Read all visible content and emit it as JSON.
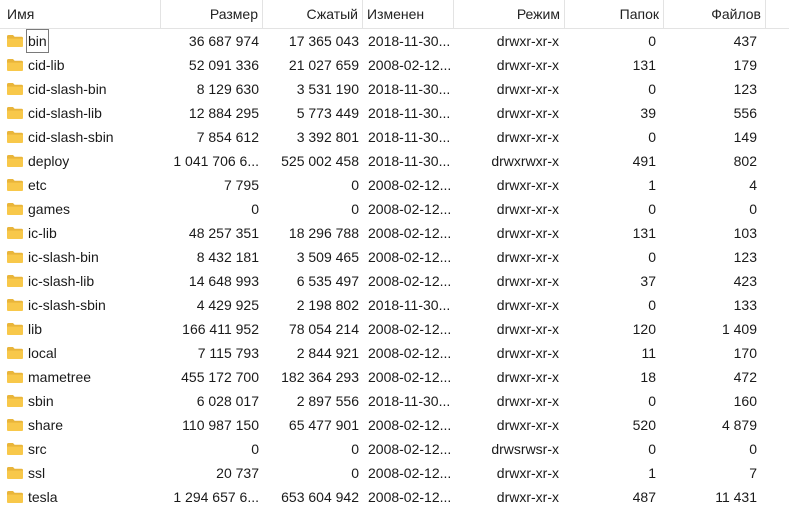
{
  "columns": {
    "name": "Имя",
    "size": "Размер",
    "compressed": "Сжатый",
    "modified": "Изменен",
    "mode": "Режим",
    "folders": "Папок",
    "files": "Файлов"
  },
  "rows": [
    {
      "name": "bin",
      "size": "36 687 974",
      "compressed": "17 365 043",
      "modified": "2018-11-30...",
      "mode": "drwxr-xr-x",
      "folders": "0",
      "files": "437"
    },
    {
      "name": "cid-lib",
      "size": "52 091 336",
      "compressed": "21 027 659",
      "modified": "2008-02-12...",
      "mode": "drwxr-xr-x",
      "folders": "131",
      "files": "179"
    },
    {
      "name": "cid-slash-bin",
      "size": "8 129 630",
      "compressed": "3 531 190",
      "modified": "2018-11-30...",
      "mode": "drwxr-xr-x",
      "folders": "0",
      "files": "123"
    },
    {
      "name": "cid-slash-lib",
      "size": "12 884 295",
      "compressed": "5 773 449",
      "modified": "2018-11-30...",
      "mode": "drwxr-xr-x",
      "folders": "39",
      "files": "556"
    },
    {
      "name": "cid-slash-sbin",
      "size": "7 854 612",
      "compressed": "3 392 801",
      "modified": "2018-11-30...",
      "mode": "drwxr-xr-x",
      "folders": "0",
      "files": "149"
    },
    {
      "name": "deploy",
      "size": "1 041 706 6...",
      "compressed": "525 002 458",
      "modified": "2018-11-30...",
      "mode": "drwxrwxr-x",
      "folders": "491",
      "files": "802"
    },
    {
      "name": "etc",
      "size": "7 795",
      "compressed": "0",
      "modified": "2008-02-12...",
      "mode": "drwxr-xr-x",
      "folders": "1",
      "files": "4"
    },
    {
      "name": "games",
      "size": "0",
      "compressed": "0",
      "modified": "2008-02-12...",
      "mode": "drwxr-xr-x",
      "folders": "0",
      "files": "0"
    },
    {
      "name": "ic-lib",
      "size": "48 257 351",
      "compressed": "18 296 788",
      "modified": "2008-02-12...",
      "mode": "drwxr-xr-x",
      "folders": "131",
      "files": "103"
    },
    {
      "name": "ic-slash-bin",
      "size": "8 432 181",
      "compressed": "3 509 465",
      "modified": "2008-02-12...",
      "mode": "drwxr-xr-x",
      "folders": "0",
      "files": "123"
    },
    {
      "name": "ic-slash-lib",
      "size": "14 648 993",
      "compressed": "6 535 497",
      "modified": "2008-02-12...",
      "mode": "drwxr-xr-x",
      "folders": "37",
      "files": "423"
    },
    {
      "name": "ic-slash-sbin",
      "size": "4 429 925",
      "compressed": "2 198 802",
      "modified": "2018-11-30...",
      "mode": "drwxr-xr-x",
      "folders": "0",
      "files": "133"
    },
    {
      "name": "lib",
      "size": "166 411 952",
      "compressed": "78 054 214",
      "modified": "2008-02-12...",
      "mode": "drwxr-xr-x",
      "folders": "120",
      "files": "1 409"
    },
    {
      "name": "local",
      "size": "7 115 793",
      "compressed": "2 844 921",
      "modified": "2008-02-12...",
      "mode": "drwxr-xr-x",
      "folders": "11",
      "files": "170"
    },
    {
      "name": "mametree",
      "size": "455 172 700",
      "compressed": "182 364 293",
      "modified": "2008-02-12...",
      "mode": "drwxr-xr-x",
      "folders": "18",
      "files": "472"
    },
    {
      "name": "sbin",
      "size": "6 028 017",
      "compressed": "2 897 556",
      "modified": "2018-11-30...",
      "mode": "drwxr-xr-x",
      "folders": "0",
      "files": "160"
    },
    {
      "name": "share",
      "size": "110 987 150",
      "compressed": "65 477 901",
      "modified": "2008-02-12...",
      "mode": "drwxr-xr-x",
      "folders": "520",
      "files": "4 879"
    },
    {
      "name": "src",
      "size": "0",
      "compressed": "0",
      "modified": "2008-02-12...",
      "mode": "drwsrwsr-x",
      "folders": "0",
      "files": "0"
    },
    {
      "name": "ssl",
      "size": "20 737",
      "compressed": "0",
      "modified": "2008-02-12...",
      "mode": "drwxr-xr-x",
      "folders": "1",
      "files": "7"
    },
    {
      "name": "tesla",
      "size": "1 294 657 6...",
      "compressed": "653 604 942",
      "modified": "2008-02-12...",
      "mode": "drwxr-xr-x",
      "folders": "487",
      "files": "11 431"
    }
  ],
  "icons": {
    "folder": "folder-icon"
  },
  "colors": {
    "folder_fill": "#f8c84a",
    "folder_tab": "#e9b53a",
    "header_divider": "#e3e3e3"
  }
}
